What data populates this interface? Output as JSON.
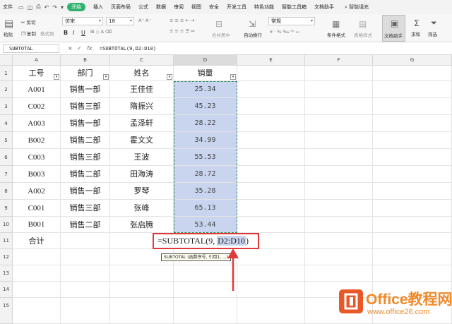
{
  "menu": {
    "file": "文件",
    "tabs": [
      "开始",
      "插入",
      "页面布局",
      "公式",
      "数据",
      "审阅",
      "视图",
      "安全",
      "开发工具",
      "特色功能",
      "智能工具箱",
      "文档助手"
    ],
    "active_tab": "开始",
    "search": "智能填充"
  },
  "ribbon": {
    "cut": "剪切",
    "paste": "粘贴",
    "copy": "复制",
    "format_painter": "格式刷",
    "font_name": "仿宋",
    "font_size": "18",
    "bold": "B",
    "italic": "I",
    "underline": "U",
    "merge_center": "合并居中",
    "wrap": "自动换行",
    "number_format": "常规",
    "conditional_format": "条件格式",
    "table_style": "表格样式",
    "doc_helper": "文档助手",
    "sum": "求和",
    "filter": "筛选"
  },
  "formula_bar": {
    "name_box": "SUBTOTAL",
    "cancel": "×",
    "confirm": "✓",
    "fx": "fx",
    "formula": "=SUBTOTAL(9,D2:D10)"
  },
  "columns": [
    "A",
    "B",
    "C",
    "D",
    "E",
    "F",
    "G"
  ],
  "rows": [
    "1",
    "2",
    "3",
    "4",
    "5",
    "6",
    "7",
    "8",
    "9",
    "10",
    "11",
    "12",
    "13",
    "14",
    "15"
  ],
  "header_row": [
    "工号",
    "部门",
    "姓名",
    "销量"
  ],
  "data_rows": [
    [
      "A001",
      "销售一部",
      "王佳佳",
      "25.34"
    ],
    [
      "C002",
      "销售三部",
      "隋振兴",
      "45.23"
    ],
    [
      "A003",
      "销售一部",
      "孟泽轩",
      "28.22"
    ],
    [
      "B002",
      "销售二部",
      "霍文文",
      "34.99"
    ],
    [
      "C003",
      "销售三部",
      "王波",
      "55.53"
    ],
    [
      "B003",
      "销售二部",
      "田海涛",
      "28.72"
    ],
    [
      "A002",
      "销售一部",
      "罗琴",
      "35.28"
    ],
    [
      "C001",
      "销售三部",
      "张峰",
      "65.13"
    ],
    [
      "B001",
      "销售二部",
      "张启腾",
      "53.44"
    ]
  ],
  "total_label": "合计",
  "editing": {
    "prefix": "=SUBTOTAL(9, ",
    "ref": "D2:D10",
    "suffix": ")"
  },
  "tooltip": "SUBTOTAL (函数序号, 引用1, ...)",
  "watermark": {
    "title": "Office教程网",
    "url": "www.office26.com"
  },
  "colors": {
    "accent": "#2fb36e",
    "selection": "#c9d5ef",
    "highlight_red": "#e0383b",
    "brand_orange": "#f08a2a"
  }
}
